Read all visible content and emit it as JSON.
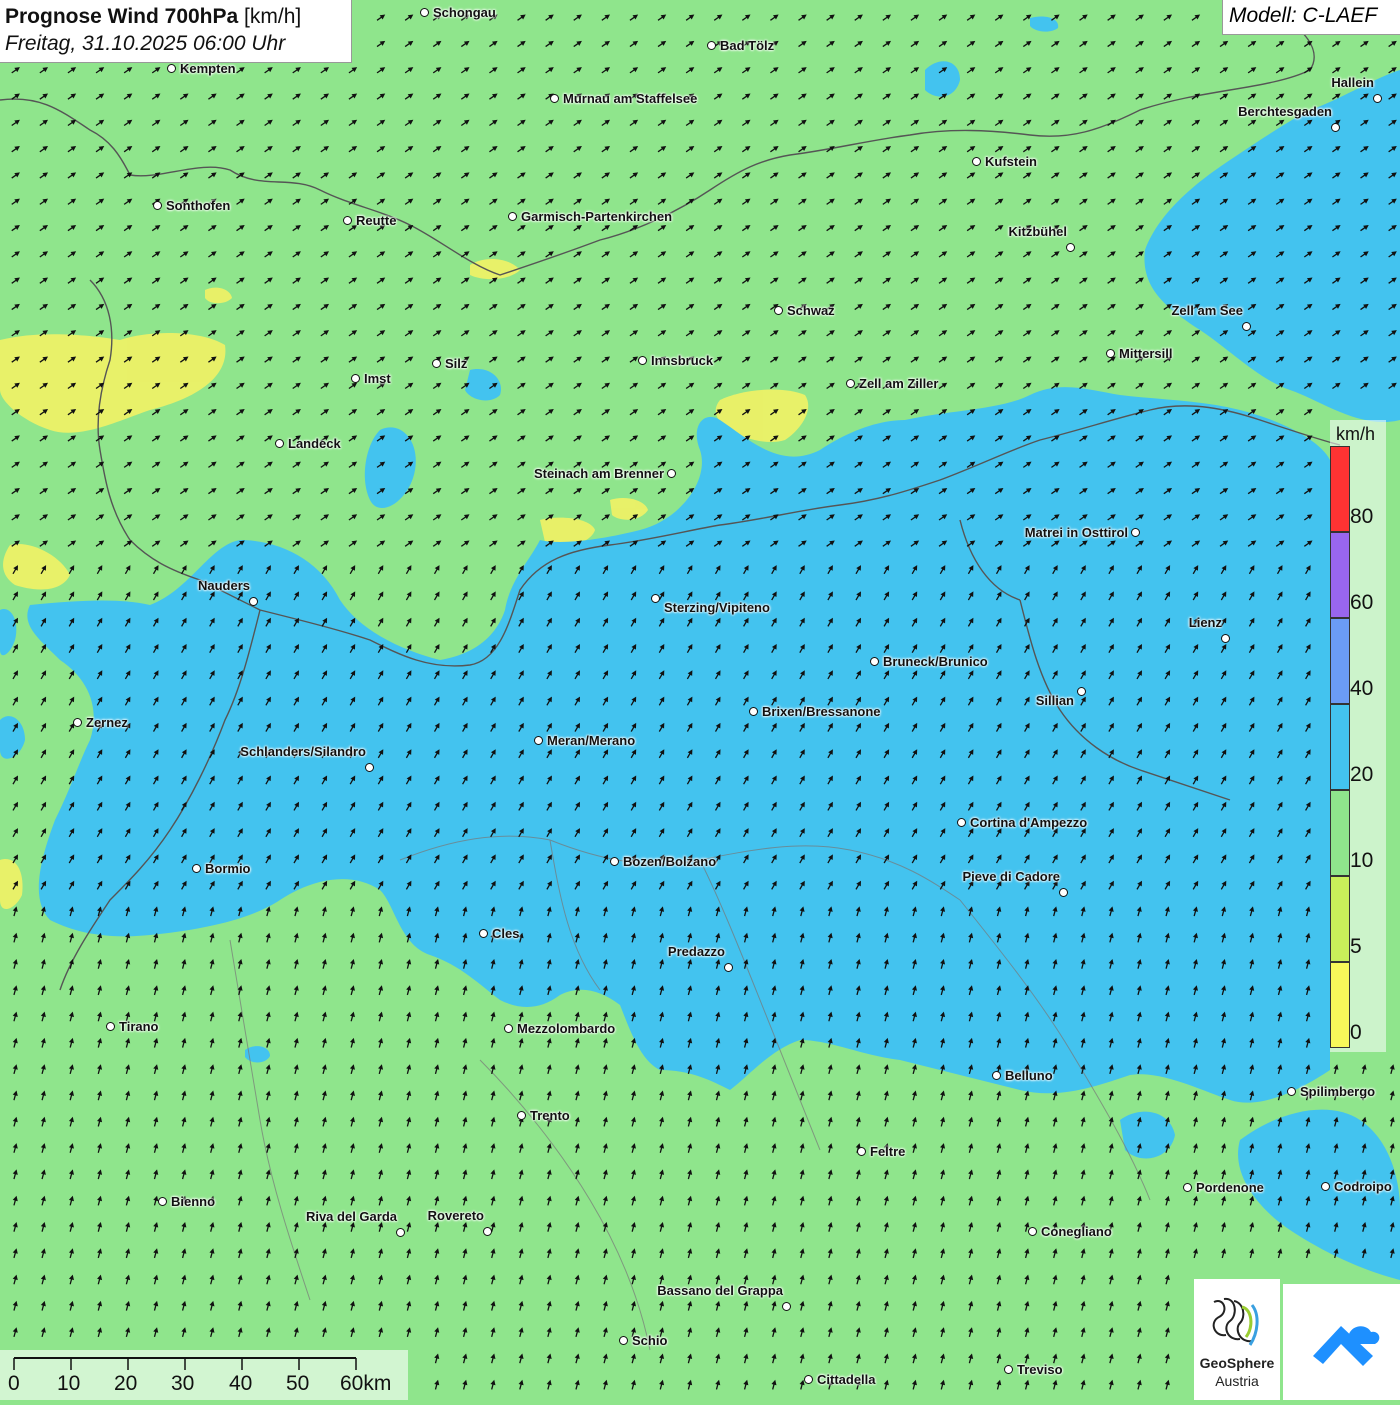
{
  "header": {
    "title_bold": "Prognose Wind 700hPa",
    "title_unit": "[km/h]",
    "subtitle": "Freitag, 31.10.2025 06:00 Uhr",
    "model": "Modell: C-LAEF"
  },
  "legend": {
    "unit": "km/h",
    "classes": [
      {
        "label": "0",
        "color": "#f7f75a"
      },
      {
        "label": "5",
        "color": "#c8ef5a"
      },
      {
        "label": "10",
        "color": "#8fe58c"
      },
      {
        "label": "20",
        "color": "#43c3ef"
      },
      {
        "label": "40",
        "color": "#6b9bf5"
      },
      {
        "label": "60",
        "color": "#9966ee"
      },
      {
        "label": "80",
        "color": "#ff3333"
      }
    ]
  },
  "scalebar": {
    "labels": [
      "0",
      "10",
      "20",
      "30",
      "40",
      "50",
      "60km"
    ]
  },
  "logos": {
    "geosphere_line1": "GeoSphere",
    "geosphere_line2": "Austria"
  },
  "wind": {
    "direction": "south-west",
    "style": "black arrows on a regular grid"
  },
  "colors": {
    "calm_green": "#8fe58c",
    "wind_blue": "#43c3ef",
    "low_yellow": "#f2f265",
    "border": "#555555"
  },
  "cities": [
    {
      "name": "Schongau"
    },
    {
      "name": "Bad Tölz"
    },
    {
      "name": "Kempten"
    },
    {
      "name": "Murnau am Staffelsee"
    },
    {
      "name": "Hallein"
    },
    {
      "name": "Berchtesgaden"
    },
    {
      "name": "Kufstein"
    },
    {
      "name": "Sonthofen"
    },
    {
      "name": "Reutte"
    },
    {
      "name": "Garmisch-Partenkirchen"
    },
    {
      "name": "Kitzbühel"
    },
    {
      "name": "Schwaz"
    },
    {
      "name": "Zell am See"
    },
    {
      "name": "Mittersill"
    },
    {
      "name": "Silz"
    },
    {
      "name": "Innsbruck"
    },
    {
      "name": "Imst"
    },
    {
      "name": "Zell am Ziller"
    },
    {
      "name": "Landeck"
    },
    {
      "name": "Steinach am Brenner"
    },
    {
      "name": "Matrei in Osttirol"
    },
    {
      "name": "Nauders"
    },
    {
      "name": "Sterzing/Vipiteno"
    },
    {
      "name": "Lienz"
    },
    {
      "name": "Bruneck/Brunico"
    },
    {
      "name": "Sillian"
    },
    {
      "name": "Zernez"
    },
    {
      "name": "Brixen/Bressanone"
    },
    {
      "name": "Meran/Merano"
    },
    {
      "name": "Schlanders/Silandro"
    },
    {
      "name": "Cortina d'Ampezzo"
    },
    {
      "name": "Bozen/Bolzano"
    },
    {
      "name": "Bormio"
    },
    {
      "name": "Pieve di Cadore"
    },
    {
      "name": "Cles"
    },
    {
      "name": "Predazzo"
    },
    {
      "name": "Tirano"
    },
    {
      "name": "Mezzolombardo"
    },
    {
      "name": "Belluno"
    },
    {
      "name": "Spilimbergo"
    },
    {
      "name": "Trento"
    },
    {
      "name": "Feltre"
    },
    {
      "name": "Pordenone"
    },
    {
      "name": "Codroipo"
    },
    {
      "name": "Bienno"
    },
    {
      "name": "Riva del Garda"
    },
    {
      "name": "Rovereto"
    },
    {
      "name": "Conegliano"
    },
    {
      "name": "Bassano del Grappa"
    },
    {
      "name": "Schio"
    },
    {
      "name": "Treviso"
    },
    {
      "name": "Cittadella"
    }
  ]
}
